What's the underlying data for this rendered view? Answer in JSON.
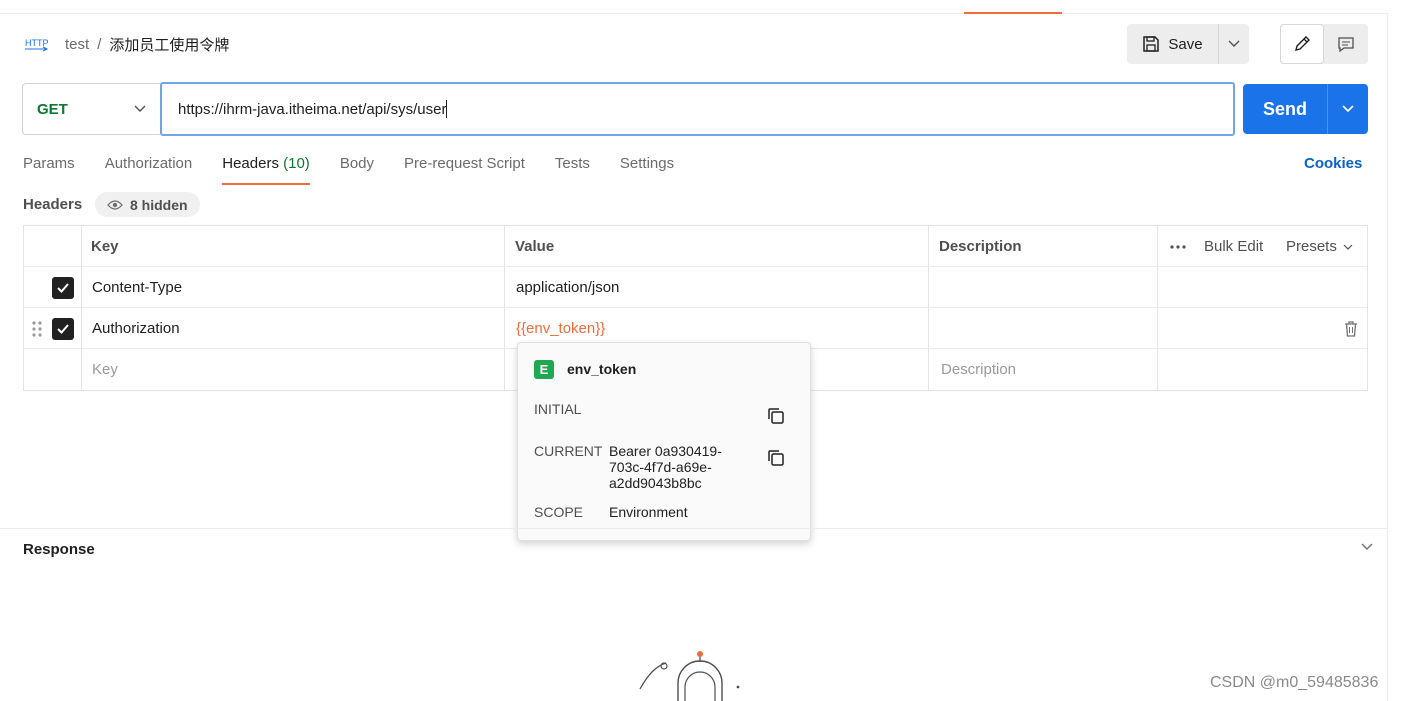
{
  "header": {
    "method_icon_label": "HTTP",
    "collection": "test",
    "separator": "/",
    "request_name": "添加员工使用令牌",
    "save_label": "Save"
  },
  "request": {
    "method": "GET",
    "url": "https://ihrm-java.itheima.net/api/sys/user",
    "send_label": "Send"
  },
  "tabs": [
    {
      "label": "Params"
    },
    {
      "label": "Authorization"
    },
    {
      "label": "Headers",
      "count": "(10)",
      "active": true
    },
    {
      "label": "Body"
    },
    {
      "label": "Pre-request Script"
    },
    {
      "label": "Tests"
    },
    {
      "label": "Settings"
    }
  ],
  "cookies_label": "Cookies",
  "headers_section": {
    "title": "Headers",
    "hidden_label": "8 hidden"
  },
  "table": {
    "columns": {
      "key": "Key",
      "value": "Value",
      "description": "Description"
    },
    "bulk_edit": "Bulk Edit",
    "presets": "Presets",
    "rows": [
      {
        "key": "Content-Type",
        "value": "application/json",
        "checked": true
      },
      {
        "key": "Authorization",
        "value": "{{env_token}}",
        "checked": true
      }
    ],
    "placeholder": {
      "key": "Key",
      "description": "Description"
    }
  },
  "popover": {
    "badge": "E",
    "variable": "env_token",
    "initial_label": "INITIAL",
    "initial_value": "",
    "current_label": "CURRENT",
    "current_value": "Bearer 0a930419-703c-4f7d-a69e-a2dd9043b8bc",
    "current_lines": [
      "Bearer 0a930419-",
      "703c-4f7d-a69e-",
      "a2dd9043b8bc"
    ],
    "scope_label": "SCOPE",
    "scope_value": "Environment"
  },
  "response": {
    "title": "Response"
  },
  "watermark": "CSDN @m0_59485836",
  "colors": {
    "accent": "#f26b3a",
    "send": "#1a73e8",
    "method_get": "#0a7a32",
    "link": "#0a64c8",
    "env_badge": "#1fa84f"
  }
}
